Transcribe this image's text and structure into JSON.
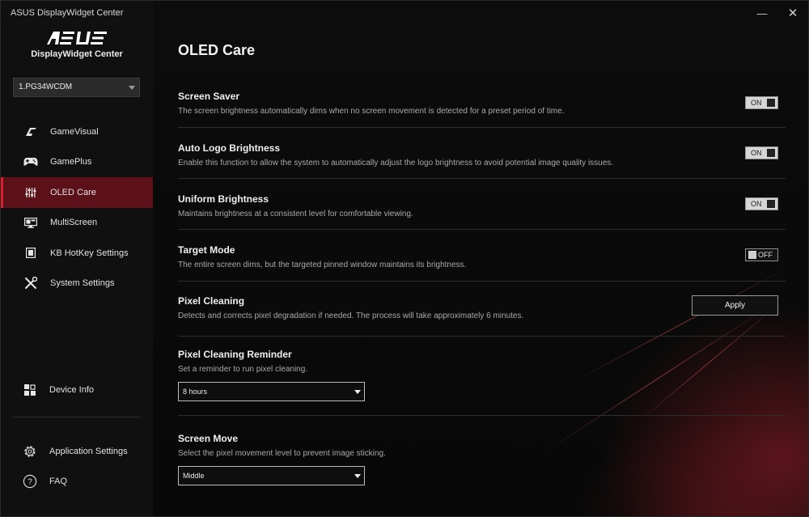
{
  "window": {
    "title": "ASUS DisplayWidget Center",
    "minimize_glyph": "—",
    "close_glyph": "✕"
  },
  "sidebar": {
    "brand_name": "ASUS",
    "brand_subtitle": "DisplayWidget Center",
    "monitor_selected": "1.PG34WCDM",
    "nav": [
      {
        "label": "GameVisual",
        "icon": "gamevisual-icon"
      },
      {
        "label": "GamePlus",
        "icon": "gamepad-icon"
      },
      {
        "label": "OLED Care",
        "icon": "sliders-icon",
        "active": true
      },
      {
        "label": "MultiScreen",
        "icon": "multiscreen-icon"
      },
      {
        "label": "KB HotKey Settings",
        "icon": "keyboard-hotkey-icon"
      },
      {
        "label": "System Settings",
        "icon": "wrench-screwdriver-icon"
      }
    ],
    "device_info": {
      "label": "Device Info",
      "icon": "device-info-icon"
    },
    "app_settings": {
      "label": "Application Settings",
      "icon": "gear-icon"
    },
    "faq": {
      "label": "FAQ",
      "icon": "question-icon"
    }
  },
  "main": {
    "title": "OLED Care",
    "screen_saver": {
      "label": "Screen Saver",
      "desc": "The screen brightness automatically dims when no screen movement is detected for a preset period of time.",
      "state": "ON"
    },
    "auto_logo": {
      "label": "Auto Logo Brightness",
      "desc": "Enable this function to allow the system to automatically adjust the logo brightness to avoid potential image quality issues.",
      "state": "ON"
    },
    "uniform_brightness": {
      "label": "Uniform Brightness",
      "desc": "Maintains brightness at a consistent level for comfortable viewing.",
      "state": "ON"
    },
    "target_mode": {
      "label": "Target Mode",
      "desc": "The entire screen dims, but the targeted pinned window maintains its brightness.",
      "state": "OFF"
    },
    "pixel_cleaning": {
      "label": "Pixel Cleaning",
      "desc": "Detects and corrects pixel degradation if needed. The process will take approximately 6 minutes.",
      "button": "Apply"
    },
    "pixel_cleaning_reminder": {
      "label": "Pixel Cleaning Reminder",
      "desc": "Set a reminder to run pixel cleaning.",
      "value": "8 hours"
    },
    "screen_move": {
      "label": "Screen Move",
      "desc": "Select the pixel movement level to prevent image sticking.",
      "value": "Middle"
    }
  },
  "colors": {
    "accent": "#d81f2b",
    "active_nav_bg": "#5c1017",
    "background": "#050505"
  }
}
